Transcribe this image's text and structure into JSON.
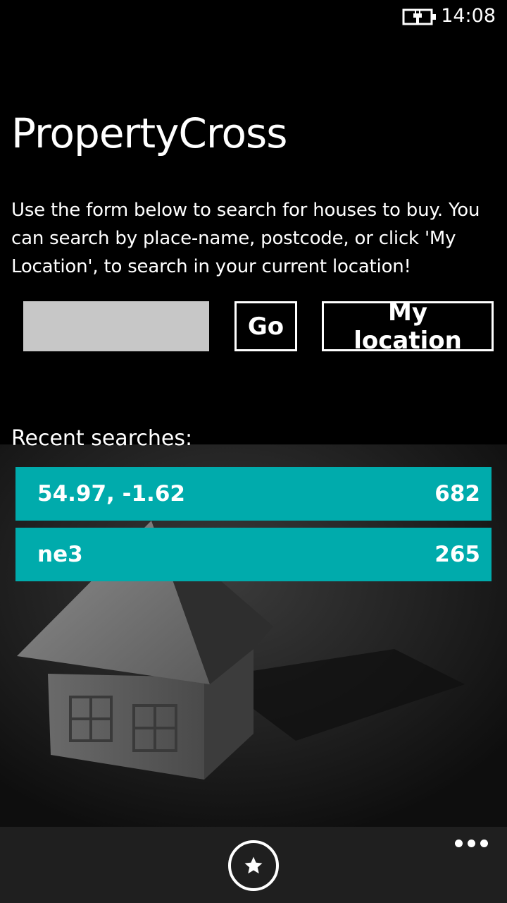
{
  "status_bar": {
    "time": "14:08",
    "battery_icon": "battery-charging-icon"
  },
  "header": {
    "title": "PropertyCross"
  },
  "intro_text": "Use the form below to search for houses to buy. You can search by place-name, postcode, or click 'My Location', to search in your current location!",
  "search": {
    "value": "",
    "placeholder": ""
  },
  "buttons": {
    "go_label": "Go",
    "my_location_label": "My location"
  },
  "recent": {
    "label": "Recent searches:",
    "items": [
      {
        "query": "54.97, -1.62",
        "count": "682"
      },
      {
        "query": "ne3",
        "count": "265"
      }
    ]
  },
  "app_bar": {
    "favourites_icon": "star-icon",
    "more_icon": "ellipsis-icon"
  },
  "colors": {
    "accent": "#00abac",
    "background": "#000000",
    "app_bar": "#1f1f1f",
    "input": "#c7c7c7"
  }
}
